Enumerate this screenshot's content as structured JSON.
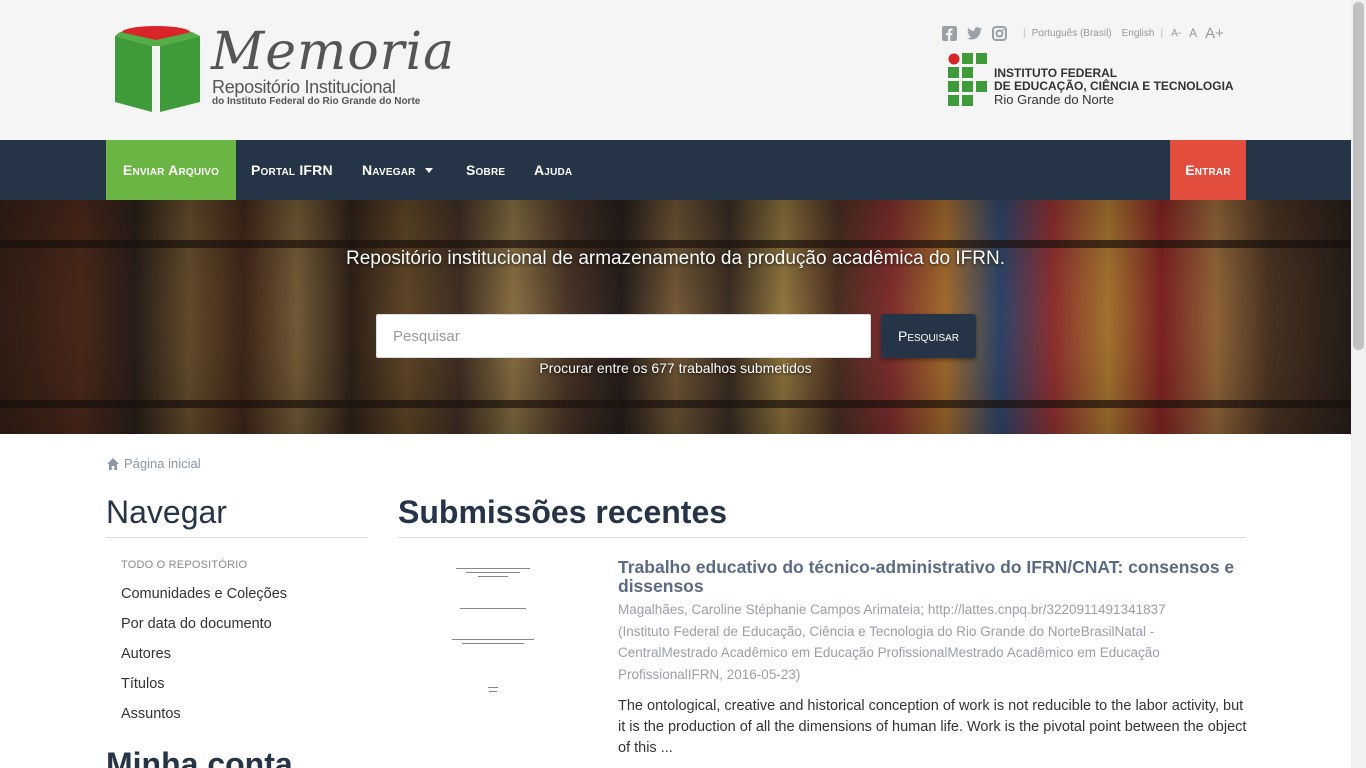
{
  "header": {
    "logo_title": "Memoria",
    "logo_sub1": "Repositório Institucional",
    "logo_sub2": "do Instituto Federal do Rio Grande do Norte",
    "lang_pt": "Português (Brasil)",
    "lang_en": "English",
    "font_small": "A-",
    "font_normal": "A",
    "font_large": "A+",
    "inst_line1": "INSTITUTO FEDERAL",
    "inst_line2": "DE EDUCAÇÃO, CIÊNCIA E TECNOLOGIA",
    "inst_line3": "Rio Grande do Norte",
    "icons": [
      "facebook-icon",
      "twitter-icon",
      "instagram-icon"
    ]
  },
  "nav": {
    "enviar": "Enviar Arquivo",
    "portal": "Portal IFRN",
    "navegar": "Navegar",
    "sobre": "Sobre",
    "ajuda": "Ajuda",
    "entrar": "Entrar"
  },
  "hero": {
    "tagline": "Repositório institucional de armazenamento da produção acadêmica do IFRN.",
    "search_placeholder": "Pesquisar",
    "search_button": "Pesquisar",
    "count_text": "Procurar entre os 677 trabalhos submetidos"
  },
  "breadcrumb": {
    "home": "Página inicial"
  },
  "sidebar": {
    "title": "Navegar",
    "group": "TODO O REPOSITÓRIO",
    "items": [
      {
        "label": "Comunidades e Coleções"
      },
      {
        "label": "Por data do documento"
      },
      {
        "label": "Autores"
      },
      {
        "label": "Títulos"
      },
      {
        "label": "Assuntos"
      }
    ],
    "title2": "Minha conta"
  },
  "main": {
    "title": "Submissões recentes",
    "item": {
      "title": "Trabalho educativo do técnico-administrativo do IFRN/CNAT: consensos e dissensos",
      "meta": "Magalhães, Caroline Stéphanie Campos Arimateia; http://lattes.cnpq.br/3220911491341837 (Instituto Federal de Educação, Ciência e Tecnologia do Rio Grande do NorteBrasilNatal - CentralMestrado Acadêmico em Educação ProfissionalMestrado Acadêmico em Educação ProfissionalIFRN, 2016-05-23)",
      "abstract": "The ontological, creative and historical conception of work is not reducible to the labor activity, but it is the production of all the dimensions of human life. Work is the pivotal point between the object of this ..."
    }
  },
  "colors": {
    "nav_bg": "#263447",
    "enviar_bg": "#6ab543",
    "entrar_bg": "#e34d3e",
    "logo_green": "#3f9b3a",
    "logo_red": "#d9252a"
  }
}
